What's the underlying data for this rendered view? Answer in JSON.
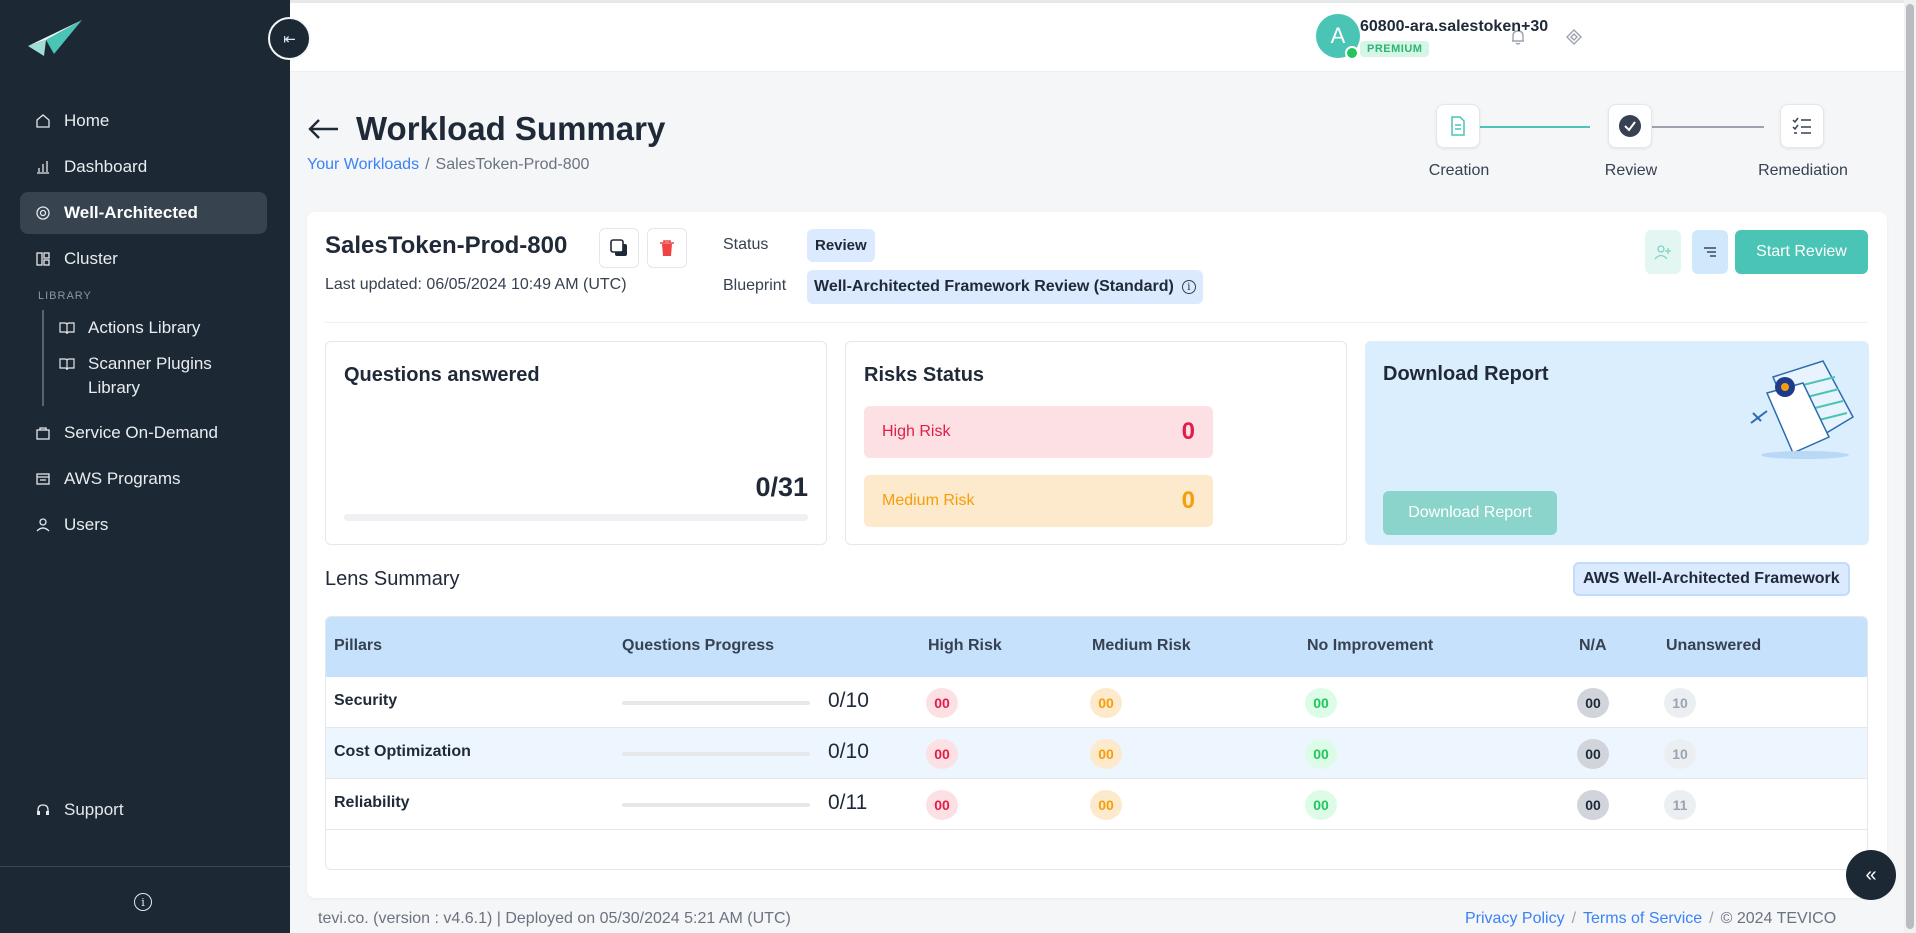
{
  "sidebar": {
    "nav": [
      {
        "label": "Home",
        "icon": "home-icon"
      },
      {
        "label": "Dashboard",
        "icon": "chart-icon"
      },
      {
        "label": "Well-Architected",
        "icon": "target-icon",
        "active": true
      },
      {
        "label": "Cluster",
        "icon": "cluster-icon"
      }
    ],
    "library_label": "LIBRARY",
    "library": [
      {
        "label": "Actions Library",
        "icon": "book-icon"
      },
      {
        "label": "Scanner Plugins Library",
        "icon": "book-icon"
      }
    ],
    "nav2": [
      {
        "label": "Service On-Demand",
        "icon": "bag-icon"
      },
      {
        "label": "AWS Programs",
        "icon": "programs-icon"
      },
      {
        "label": "Users",
        "icon": "user-icon"
      }
    ],
    "support": "Support",
    "collapse_glyph": "⇤",
    "info_glyph": "i"
  },
  "topbar": {
    "avatar_letter": "A",
    "user_name": "60800-ara.salestoken+30",
    "badge": "PREMIUM"
  },
  "header": {
    "title": "Workload Summary",
    "breadcrumb": {
      "link": "Your Workloads",
      "sep": "/",
      "current": "SalesToken-Prod-800"
    },
    "steps": [
      {
        "label": "Creation",
        "state": "done"
      },
      {
        "label": "Review",
        "state": "current"
      },
      {
        "label": "Remediation",
        "state": "pending"
      }
    ]
  },
  "workload": {
    "name": "SalesToken-Prod-800",
    "last_updated": "Last updated: 06/05/2024 10:49 AM (UTC)",
    "status_label": "Status",
    "status": "Review",
    "blueprint_label": "Blueprint",
    "blueprint": "Well-Architected Framework Review (Standard)",
    "blueprint_info": "i",
    "start_review": "Start Review"
  },
  "questions": {
    "title": "Questions answered",
    "value": "0/31",
    "progress": 0
  },
  "risks": {
    "title": "Risks Status",
    "high": {
      "label": "High Risk",
      "value": "0"
    },
    "medium": {
      "label": "Medium Risk",
      "value": "0"
    }
  },
  "report": {
    "title": "Download Report",
    "button": "Download Report"
  },
  "lens": {
    "title": "Lens Summary",
    "badge": "AWS Well-Architected Framework",
    "columns": [
      "Pillars",
      "Questions Progress",
      "High Risk",
      "Medium Risk",
      "No Improvement",
      "N/A",
      "Unanswered"
    ],
    "rows": [
      {
        "pillar": "Security",
        "progress": "0/10",
        "high": "00",
        "medium": "00",
        "none": "00",
        "na": "00",
        "unanswered": "10"
      },
      {
        "pillar": "Cost Optimization",
        "progress": "0/10",
        "high": "00",
        "medium": "00",
        "none": "00",
        "na": "00",
        "unanswered": "10"
      },
      {
        "pillar": "Reliability",
        "progress": "0/11",
        "high": "00",
        "medium": "00",
        "none": "00",
        "na": "00",
        "unanswered": "11"
      }
    ]
  },
  "footer": {
    "left": "tevi.co. (version : v4.6.1) | Deployed on 05/30/2024 5:21 AM (UTC)",
    "privacy": "Privacy Policy",
    "sep": "/",
    "terms": "Terms of Service",
    "copyright": "© 2024 TEVICO"
  },
  "float_glyph": "«",
  "colors": {
    "accent": "#4ac4b5",
    "sidebar": "#1c2834",
    "link": "#3b82f6",
    "high": "#e11d48",
    "medium": "#f59e0b",
    "none": "#22c55e"
  }
}
